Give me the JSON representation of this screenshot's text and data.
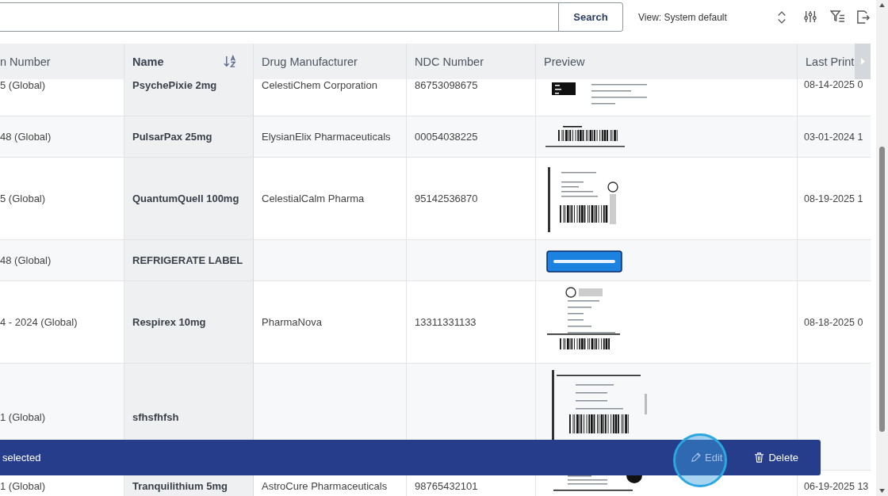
{
  "search": {
    "button": "Search"
  },
  "view": "View: System default",
  "table": {
    "columns": [
      {
        "label": "n Number",
        "sorted": false
      },
      {
        "label": "Name",
        "sorted": true
      },
      {
        "label": "Drug Manufacturer",
        "sorted": false
      },
      {
        "label": "NDC Number",
        "sorted": false
      },
      {
        "label": "Preview",
        "sorted": false
      },
      {
        "label": "Last Print",
        "sorted": false
      }
    ],
    "rows": [
      {
        "number": "5 (Global)",
        "name": "PsychePixie 2mg",
        "manufacturer": "CelestiChem Corporation",
        "ndc": "86753098675",
        "last_print": "08-14-2025 0"
      },
      {
        "number": "48 (Global)",
        "name": "PulsarPax 25mg",
        "manufacturer": "ElysianElix Pharmaceuticals",
        "ndc": "00054038225",
        "last_print": "03-01-2024 1"
      },
      {
        "number": "5 (Global)",
        "name": "QuantumQuell 100mg",
        "manufacturer": "CelestialCalm Pharma",
        "ndc": "95142536870",
        "last_print": "08-19-2025 1"
      },
      {
        "number": "48 (Global)",
        "name": "REFRIGERATE LABEL"
      },
      {
        "number": "4 - 2024 (Global)",
        "name": "Respirex 10mg",
        "manufacturer": "PharmaNova",
        "ndc": "13311331133",
        "last_print": "08-18-2025 0"
      },
      {
        "number": "1 (Global)",
        "name": "sfhsfhfsh"
      },
      {
        "number": "1 (Global)",
        "name": "Tranquilithium 5mg",
        "manufacturer": "AstroCure Pharmaceuticals",
        "ndc": "98765432101",
        "last_print": "06-19-2025 13"
      }
    ]
  },
  "action_bar": {
    "status": "selected",
    "buttons": [
      {
        "label": "Edit",
        "kind": "edit",
        "highlighted": true
      },
      {
        "label": "Delete",
        "kind": "delete",
        "highlighted": false
      }
    ]
  }
}
